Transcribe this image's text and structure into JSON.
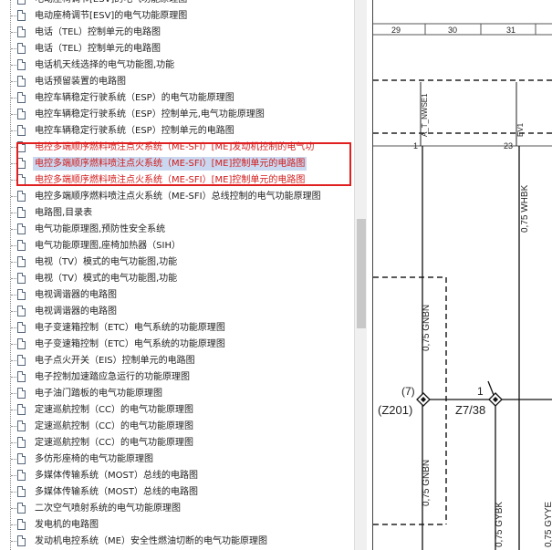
{
  "tree": {
    "items": [
      {
        "label": "电动座椅调节[ESV]的电气功能原理图",
        "state": "normal"
      },
      {
        "label": "电动座椅调节[ESV]的电气功能原理图",
        "state": "normal"
      },
      {
        "label": "电话（TEL）控制单元的电路图",
        "state": "normal"
      },
      {
        "label": "电话（TEL）控制单元的电路图",
        "state": "normal"
      },
      {
        "label": "电话机天线选择的电气功能图,功能",
        "state": "normal"
      },
      {
        "label": "电话预留装置的电路图",
        "state": "normal"
      },
      {
        "label": "电控车辆稳定行驶系统（ESP）的电气功能原理图",
        "state": "normal"
      },
      {
        "label": "电控车辆稳定行驶系统（ESP）控制单元,电气功能原理图",
        "state": "normal"
      },
      {
        "label": "电控车辆稳定行驶系统（ESP）控制单元的电路图",
        "state": "normal"
      },
      {
        "label": "电控多端顺序燃料喷注点火系统（ME-SFI）[ME]发动机控制的电气功",
        "state": "red"
      },
      {
        "label": "电控多端顺序燃料喷注点火系统（ME-SFI）[ME]控制单元的电路图",
        "state": "sel"
      },
      {
        "label": "电控多端顺序燃料喷注点火系统（ME-SFI）[ME]控制单元的电路图",
        "state": "red"
      },
      {
        "label": "电控多端顺序燃料喷注点火系统（ME-SFI）总线控制的电气功能原理图",
        "state": "normal"
      },
      {
        "label": "电路图,目录表",
        "state": "normal"
      },
      {
        "label": "电气功能原理图,预防性安全系统",
        "state": "normal"
      },
      {
        "label": "电气功能原理图,座椅加热器（SIH）",
        "state": "normal"
      },
      {
        "label": "电视（TV）模式的电气功能图,功能",
        "state": "normal"
      },
      {
        "label": "电视（TV）模式的电气功能图,功能",
        "state": "normal"
      },
      {
        "label": "电视调谐器的电路图",
        "state": "normal"
      },
      {
        "label": "电视调谐器的电路图",
        "state": "normal"
      },
      {
        "label": "电子变速箱控制（ETC）电气系统的功能原理图",
        "state": "normal"
      },
      {
        "label": "电子变速箱控制（ETC）电气系统的功能原理图",
        "state": "normal"
      },
      {
        "label": "电子点火开关（EIS）控制单元的电路图",
        "state": "normal"
      },
      {
        "label": "电子控制加速踏应急运行的功能原理图",
        "state": "normal"
      },
      {
        "label": "电子油门踏板的电气功能原理图",
        "state": "normal"
      },
      {
        "label": "定速巡航控制（CC）的电气功能原理图",
        "state": "normal"
      },
      {
        "label": "定速巡航控制（CC）的电气功能原理图",
        "state": "normal"
      },
      {
        "label": "定速巡航控制（CC）的电气功能原理图",
        "state": "normal"
      },
      {
        "label": "多仿形座椅的电气功能原理图",
        "state": "normal"
      },
      {
        "label": "多媒体传输系统（MOST）总线的电路图",
        "state": "normal"
      },
      {
        "label": "多媒体传输系统（MOST）总线的电路图",
        "state": "normal"
      },
      {
        "label": "二次空气喷射系统的电气功能原理图",
        "state": "normal"
      },
      {
        "label": "发电机的电路图",
        "state": "normal"
      },
      {
        "label": "发动机电控系统（ME）安全性燃油切断的电气功能原理图",
        "state": "normal"
      }
    ]
  },
  "diagram": {
    "columns": [
      "29",
      "30",
      "31"
    ],
    "connector_label_1": "A_T_NWSE1",
    "connector_label_2": "EV1",
    "pin_1": "1",
    "pin_2": "23",
    "wire_whbk": "0,75 WHBK",
    "wire_gnbn_upper": "0,75 GNBN",
    "wire_gnbn_lower": "0,75 GNBN",
    "wire_gybk": "0,75 GYBK",
    "wire_gyye": "0,75 GYYE",
    "node_left_pin": "(7)",
    "node_left_name": "(Z201)",
    "node_right_pin": "1",
    "node_right_name": "Z7/38"
  }
}
